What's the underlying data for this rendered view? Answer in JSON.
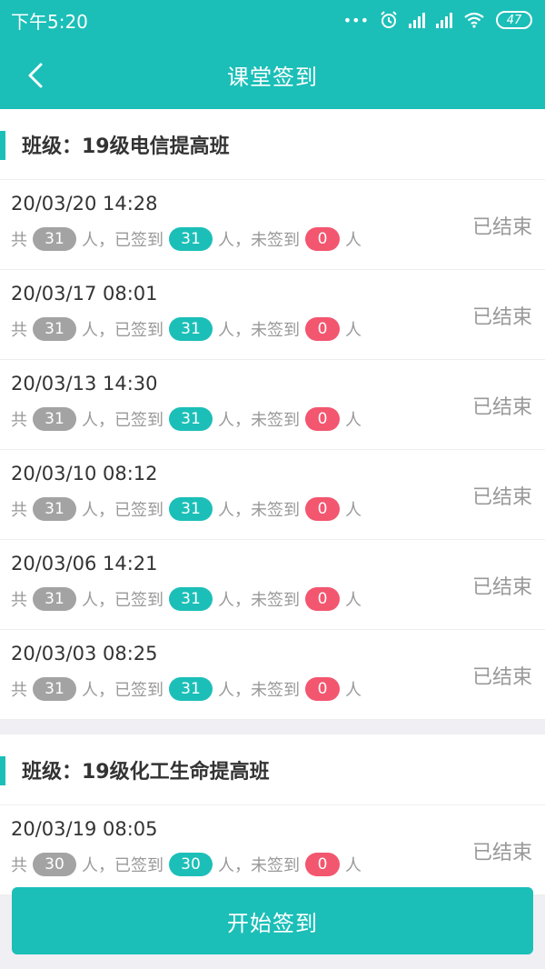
{
  "status_bar": {
    "time": "下午5:20",
    "dots": "•••",
    "battery": "47"
  },
  "header": {
    "title": "课堂签到"
  },
  "sections": [
    {
      "class_title": "班级：19级电信提高班",
      "records": [
        {
          "time": "20/03/20 14:28",
          "total_prefix": "共",
          "total": "31",
          "signed_label": "人，已签到",
          "signed": "31",
          "unsigned_label": "人，未签到",
          "unsigned": "0",
          "suffix": "人",
          "status": "已结束"
        },
        {
          "time": "20/03/17 08:01",
          "total_prefix": "共",
          "total": "31",
          "signed_label": "人，已签到",
          "signed": "31",
          "unsigned_label": "人，未签到",
          "unsigned": "0",
          "suffix": "人",
          "status": "已结束"
        },
        {
          "time": "20/03/13 14:30",
          "total_prefix": "共",
          "total": "31",
          "signed_label": "人，已签到",
          "signed": "31",
          "unsigned_label": "人，未签到",
          "unsigned": "0",
          "suffix": "人",
          "status": "已结束"
        },
        {
          "time": "20/03/10 08:12",
          "total_prefix": "共",
          "total": "31",
          "signed_label": "人，已签到",
          "signed": "31",
          "unsigned_label": "人，未签到",
          "unsigned": "0",
          "suffix": "人",
          "status": "已结束"
        },
        {
          "time": "20/03/06 14:21",
          "total_prefix": "共",
          "total": "31",
          "signed_label": "人，已签到",
          "signed": "31",
          "unsigned_label": "人，未签到",
          "unsigned": "0",
          "suffix": "人",
          "status": "已结束"
        },
        {
          "time": "20/03/03 08:25",
          "total_prefix": "共",
          "total": "31",
          "signed_label": "人，已签到",
          "signed": "31",
          "unsigned_label": "人，未签到",
          "unsigned": "0",
          "suffix": "人",
          "status": "已结束"
        }
      ]
    },
    {
      "class_title": "班级：19级化工生命提高班",
      "records": [
        {
          "time": "20/03/19 08:05",
          "total_prefix": "共",
          "total": "30",
          "signed_label": "人，已签到",
          "signed": "30",
          "unsigned_label": "人，未签到",
          "unsigned": "0",
          "suffix": "人",
          "status": "已结束"
        }
      ]
    }
  ],
  "start_button": "开始签到",
  "colors": {
    "primary": "#1bbfb8",
    "pill_total": "#a3a3a3",
    "pill_unsigned": "#f3566f"
  }
}
